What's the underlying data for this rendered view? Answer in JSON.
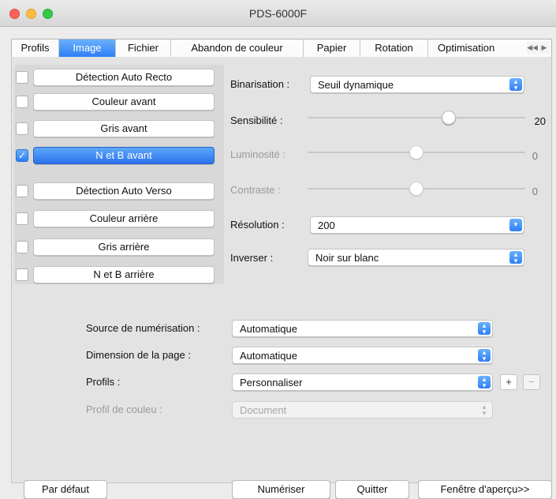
{
  "window": {
    "title": "PDS-6000F"
  },
  "tabs": [
    {
      "label": "Profils"
    },
    {
      "label": "Image"
    },
    {
      "label": "Fichier"
    },
    {
      "label": "Abandon de couleur"
    },
    {
      "label": "Papier"
    },
    {
      "label": "Rotation"
    },
    {
      "label": "Optimisation"
    }
  ],
  "tab_arrows": {
    "prev": "◀◀",
    "next": "▶"
  },
  "modes": [
    {
      "label": "Détection Auto Recto",
      "checked": false
    },
    {
      "label": "Couleur avant",
      "checked": false
    },
    {
      "label": "Gris avant",
      "checked": false
    },
    {
      "label": "N et B avant",
      "checked": true
    },
    {
      "label": "Détection Auto Verso",
      "checked": false
    },
    {
      "label": "Couleur arrière",
      "checked": false
    },
    {
      "label": "Gris arrière",
      "checked": false
    },
    {
      "label": "N et B arrière",
      "checked": false
    }
  ],
  "settings": {
    "binarisation_label": "Binarisation :",
    "binarisation_value": "Seuil dynamique",
    "sensibilite_label": "Sensibilité :",
    "sensibilite_value": "20",
    "sensibilite_level": 0.65,
    "luminosite_label": "Luminosité :",
    "luminosite_value": "0",
    "luminosite_level": 0.5,
    "contraste_label": "Contraste :",
    "contraste_value": "0",
    "contraste_level": 0.5,
    "resolution_label": "Résolution :",
    "resolution_value": "200",
    "inverser_label": "Inverser :",
    "inverser_value": "Noir sur blanc"
  },
  "scan": {
    "source_label": "Source de numérisation :",
    "source_value": "Automatique",
    "page_label": "Dimension de la page :",
    "page_value": "Automatique",
    "profils_label": "Profils :",
    "profils_value": "Personnaliser",
    "add_label": "+",
    "remove_label": "−",
    "color_profile_label": "Profil de couleu :",
    "color_profile_value": "Document"
  },
  "footer": {
    "default_label": "Par défaut",
    "scan_label": "Numériser",
    "quit_label": "Quitter",
    "preview_label": "Fenêtre d'aperçu>>"
  },
  "icons": {
    "updown": "up-down-chevron-icon",
    "down": "chevron-down-icon",
    "check": "checkmark-icon"
  },
  "colors": {
    "accent": "#2f7ff6"
  }
}
